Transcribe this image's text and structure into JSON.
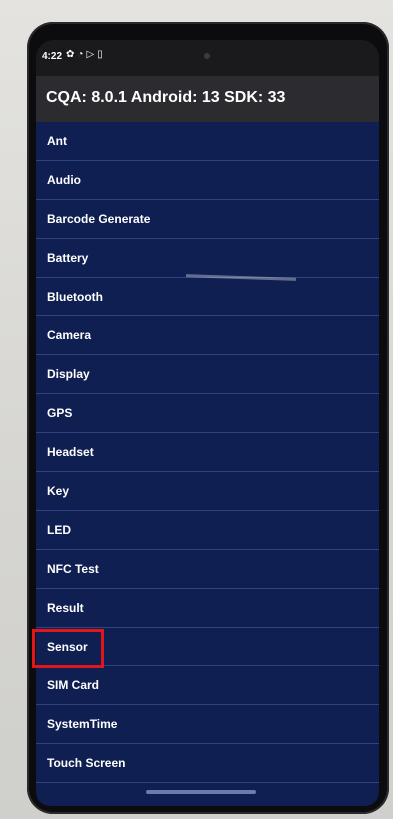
{
  "status": {
    "time": "4:22",
    "icons": [
      "gear-icon",
      "wifi-icon",
      "play-icon",
      "sim-icon"
    ]
  },
  "app": {
    "title": "CQA: 8.0.1 Android: 13 SDK: 33"
  },
  "menu": {
    "items": [
      {
        "label": "Ant"
      },
      {
        "label": "Audio"
      },
      {
        "label": "Barcode Generate"
      },
      {
        "label": "Battery"
      },
      {
        "label": "Bluetooth"
      },
      {
        "label": "Camera"
      },
      {
        "label": "Display"
      },
      {
        "label": "GPS"
      },
      {
        "label": "Headset"
      },
      {
        "label": "Key"
      },
      {
        "label": "LED"
      },
      {
        "label": "NFC Test"
      },
      {
        "label": "Result"
      },
      {
        "label": "Sensor"
      },
      {
        "label": "SIM Card"
      },
      {
        "label": "SystemTime"
      },
      {
        "label": "Touch Screen"
      }
    ],
    "highlighted": "Sensor"
  },
  "colors": {
    "list_background": "#0f1f52",
    "title_background": "#2b2b30",
    "highlight": "#e0161c"
  }
}
